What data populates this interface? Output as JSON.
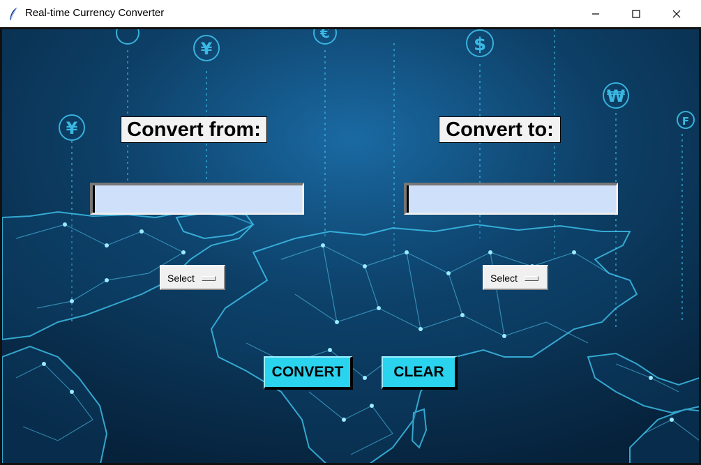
{
  "window": {
    "title": "Real-time Currency Converter",
    "app_icon": "feather-icon",
    "controls": [
      "minimize-icon",
      "maximize-icon",
      "close-icon"
    ]
  },
  "background": {
    "theme": "world-map-network",
    "currency_symbols": [
      "¥",
      "¥",
      "€",
      "$",
      "₩",
      "F"
    ],
    "colors": {
      "deep": "#06213a",
      "mid": "#0d3f66",
      "glow": "#3fc6f0"
    }
  },
  "converter": {
    "from_label": "Convert from:",
    "to_label": "Convert to:",
    "from_value": "",
    "to_value": "",
    "from_currency": "Select",
    "to_currency": "Select"
  },
  "actions": {
    "convert_label": "CONVERT",
    "clear_label": "CLEAR",
    "button_color": "#2ad3ee"
  }
}
